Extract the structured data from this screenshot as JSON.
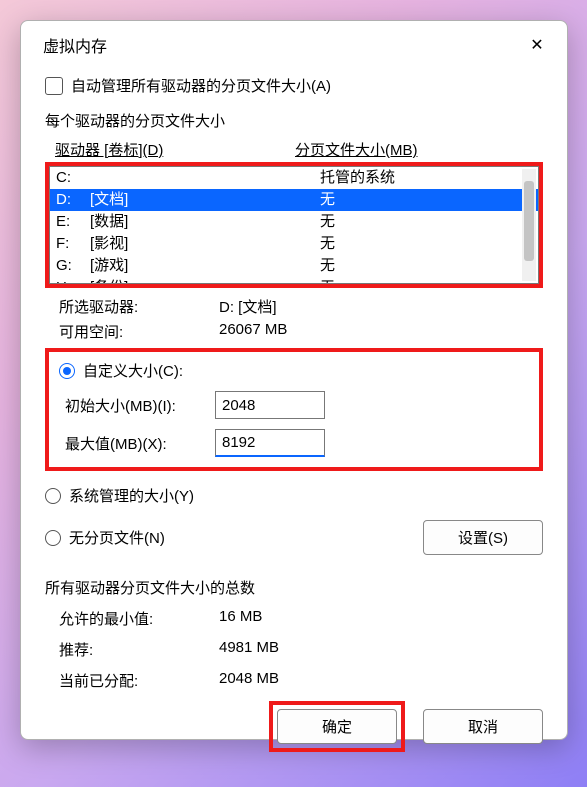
{
  "window": {
    "title": "虚拟内存"
  },
  "autoManage": {
    "label": "自动管理所有驱动器的分页文件大小(A)"
  },
  "perDrive": {
    "heading": "每个驱动器的分页文件大小",
    "col_drive": "驱动器 [卷标](D)",
    "col_pagefile": "分页文件大小(MB)",
    "rows": [
      {
        "letter": "C:",
        "label": "",
        "value": "托管的系统",
        "selected": false
      },
      {
        "letter": "D:",
        "label": "[文档]",
        "value": "无",
        "selected": true
      },
      {
        "letter": "E:",
        "label": "[数据]",
        "value": "无",
        "selected": false
      },
      {
        "letter": "F:",
        "label": "[影视]",
        "value": "无",
        "selected": false
      },
      {
        "letter": "G:",
        "label": "[游戏]",
        "value": "无",
        "selected": false
      },
      {
        "letter": "H:",
        "label": "[备份]",
        "value": "无",
        "selected": false
      }
    ]
  },
  "selectedInfo": {
    "drive_label": "所选驱动器:",
    "drive_value": "D:  [文档]",
    "free_label": "可用空间:",
    "free_value": "26067 MB"
  },
  "custom": {
    "radio_label": "自定义大小(C):",
    "initial_label": "初始大小(MB)(I):",
    "initial_value": "2048",
    "max_label": "最大值(MB)(X):",
    "max_value": "8192"
  },
  "otherRadios": {
    "system_label": "系统管理的大小(Y)",
    "none_label": "无分页文件(N)"
  },
  "setButton": "设置(S)",
  "totals": {
    "heading": "所有驱动器分页文件大小的总数",
    "min_label": "允许的最小值:",
    "min_value": "16 MB",
    "rec_label": "推荐:",
    "rec_value": "4981 MB",
    "cur_label": "当前已分配:",
    "cur_value": "2048 MB"
  },
  "buttons": {
    "ok": "确定",
    "cancel": "取消"
  },
  "highlight_color": "#ef1a1a"
}
